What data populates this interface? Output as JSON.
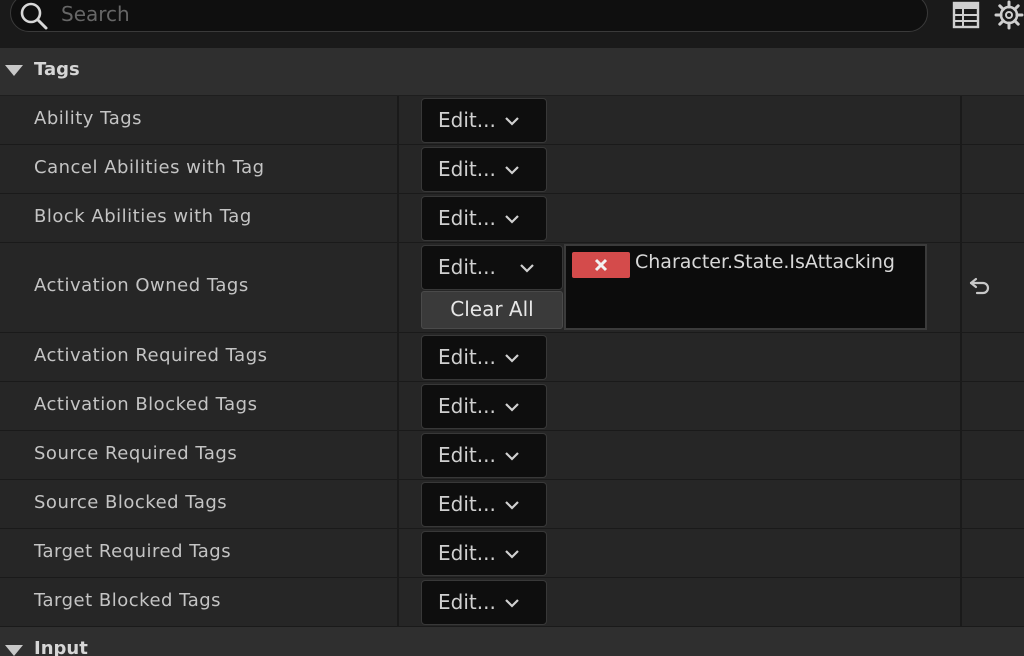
{
  "search": {
    "placeholder": "Search"
  },
  "toolbar": {
    "icons": [
      "table-view-icon",
      "settings-gear-icon"
    ]
  },
  "sections": {
    "tags": {
      "label": "Tags",
      "expanded": true
    },
    "input": {
      "label": "Input",
      "expanded": true
    }
  },
  "rows": [
    {
      "label": "Ability Tags",
      "edit_label": "Edit..."
    },
    {
      "label": "Cancel Abilities with Tag",
      "edit_label": "Edit..."
    },
    {
      "label": "Block Abilities with Tag",
      "edit_label": "Edit..."
    },
    {
      "label": "Activation Owned Tags",
      "edit_label": "Edit...",
      "clear_label": "Clear All",
      "tags": [
        "Character.State.IsAttacking"
      ],
      "has_reset": true
    },
    {
      "label": "Activation Required Tags",
      "edit_label": "Edit..."
    },
    {
      "label": "Activation Blocked Tags",
      "edit_label": "Edit..."
    },
    {
      "label": "Source Required Tags",
      "edit_label": "Edit..."
    },
    {
      "label": "Source Blocked Tags",
      "edit_label": "Edit..."
    },
    {
      "label": "Target Required Tags",
      "edit_label": "Edit..."
    },
    {
      "label": "Target Blocked Tags",
      "edit_label": "Edit..."
    }
  ],
  "colors": {
    "background": "#242424",
    "row_background": "#262626",
    "section_background": "#2f2f2f",
    "button_background": "#0e0e0e",
    "tag_remove_red": "#d44b4b"
  }
}
